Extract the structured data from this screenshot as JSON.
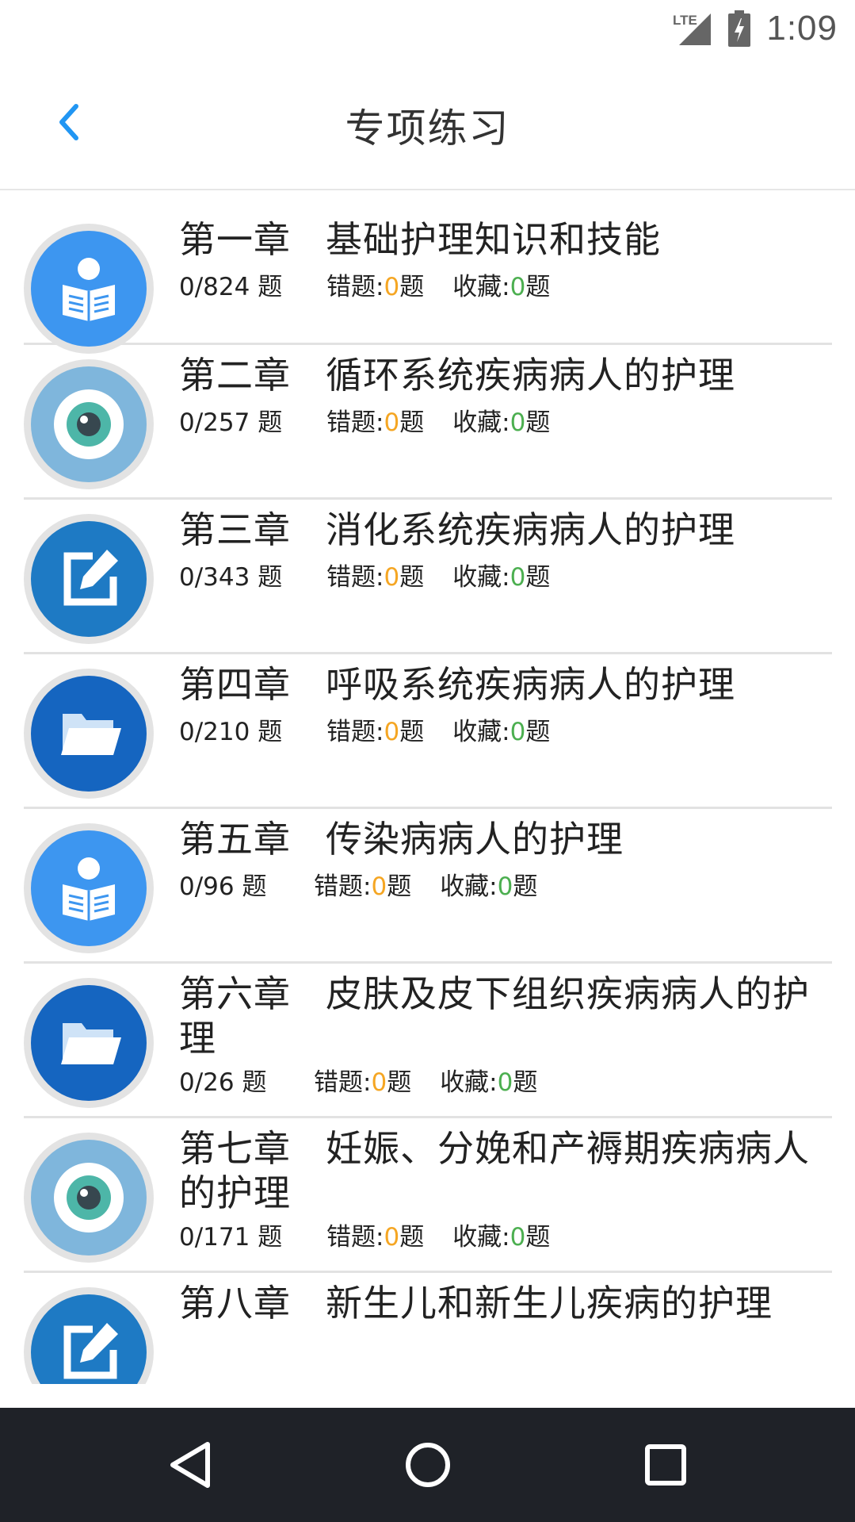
{
  "status_bar": {
    "network": "LTE",
    "time": "1:09"
  },
  "header": {
    "title": "专项练习"
  },
  "colors": {
    "accent": "#2196f3",
    "wrong_count": "#f5a623",
    "fav_count": "#4caf50",
    "nav_bg": "#1f2228"
  },
  "chapters": [
    {
      "chapter": "第一章",
      "name": "基础护理知识和技能",
      "total": "0/824 题",
      "wrong_label": "错题:",
      "wrong": "0",
      "wrong_unit": "题",
      "fav_label": "收藏:",
      "fav": "0",
      "fav_unit": "题",
      "icon": "reader-icon"
    },
    {
      "chapter": "第二章",
      "name": "循环系统疾病病人的护理",
      "total": "0/257 题",
      "wrong_label": "错题:",
      "wrong": "0",
      "wrong_unit": "题",
      "fav_label": "收藏:",
      "fav": "0",
      "fav_unit": "题",
      "icon": "eye-icon"
    },
    {
      "chapter": "第三章",
      "name": "消化系统疾病病人的护理",
      "total": "0/343 题",
      "wrong_label": "错题:",
      "wrong": "0",
      "wrong_unit": "题",
      "fav_label": "收藏:",
      "fav": "0",
      "fav_unit": "题",
      "icon": "edit-icon"
    },
    {
      "chapter": "第四章",
      "name": "呼吸系统疾病病人的护理",
      "total": "0/210 题",
      "wrong_label": "错题:",
      "wrong": "0",
      "wrong_unit": "题",
      "fav_label": "收藏:",
      "fav": "0",
      "fav_unit": "题",
      "icon": "folder-icon"
    },
    {
      "chapter": "第五章",
      "name": "传染病病人的护理",
      "total": "0/96 题",
      "wrong_label": "错题:",
      "wrong": "0",
      "wrong_unit": "题",
      "fav_label": "收藏:",
      "fav": "0",
      "fav_unit": "题",
      "icon": "reader-icon"
    },
    {
      "chapter": "第六章",
      "name": "皮肤及皮下组织疾病病人的护理",
      "total": "0/26 题",
      "wrong_label": "错题:",
      "wrong": "0",
      "wrong_unit": "题",
      "fav_label": "收藏:",
      "fav": "0",
      "fav_unit": "题",
      "icon": "folder-icon"
    },
    {
      "chapter": "第七章",
      "name": "妊娠、分娩和产褥期疾病病人的护理",
      "total": "0/171 题",
      "wrong_label": "错题:",
      "wrong": "0",
      "wrong_unit": "题",
      "fav_label": "收藏:",
      "fav": "0",
      "fav_unit": "题",
      "icon": "eye-icon"
    },
    {
      "chapter": "第八章",
      "name": "新生儿和新生儿疾病的护理",
      "icon": "edit-icon"
    }
  ]
}
